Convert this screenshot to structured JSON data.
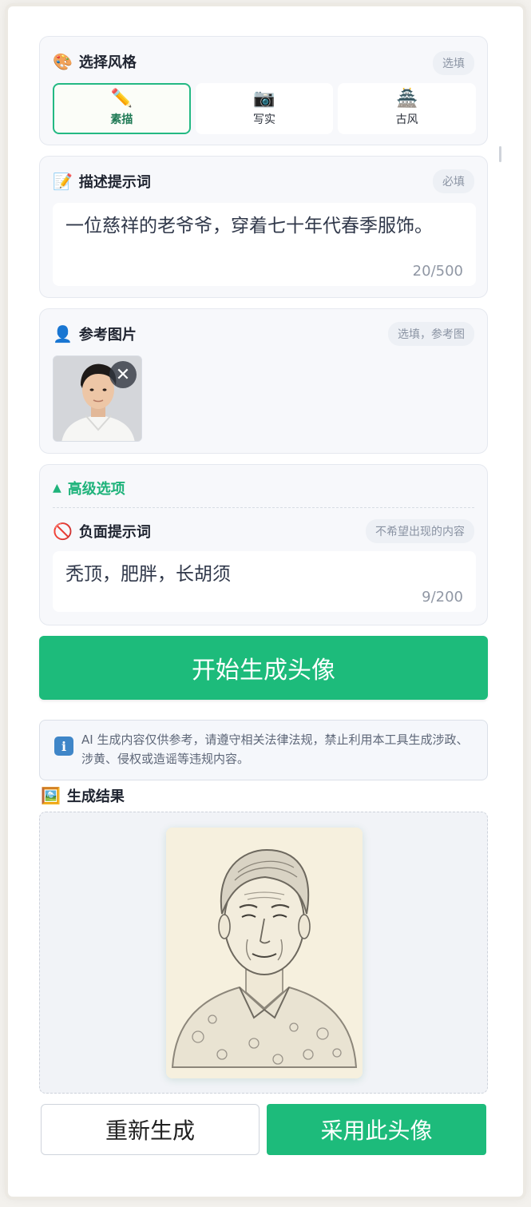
{
  "style_section": {
    "title": "选择风格",
    "icon": "palette-icon",
    "badge": "选填",
    "options": [
      {
        "label": "素描",
        "icon": "pencil-icon",
        "glyph": "✏️",
        "selected": true
      },
      {
        "label": "写实",
        "icon": "camera-icon",
        "glyph": "📷",
        "selected": false
      },
      {
        "label": "古风",
        "icon": "castle-icon",
        "glyph": "🏯",
        "selected": false
      }
    ]
  },
  "prompt_section": {
    "title": "描述提示词",
    "icon": "memo-icon",
    "badge": "必填",
    "value": "一位慈祥的老爷爷，穿着七十年代春季服饰。",
    "count": "20/500"
  },
  "reference_section": {
    "title": "参考图片",
    "icon": "bust-silhouette-icon",
    "badge": "选填，参考图",
    "remove_glyph": "✕"
  },
  "advanced_section": {
    "toggle_glyph": "▲",
    "toggle_label": "高级选项",
    "negative_title": "负面提示词",
    "negative_icon": "prohibited-icon",
    "negative_badge": "不希望出现的内容",
    "negative_value": "秃顶，肥胖，长胡须",
    "negative_count": "9/200"
  },
  "generate_button": "开始生成头像",
  "notice": {
    "icon": "info-icon",
    "glyph": "i",
    "text": "AI 生成内容仅供参考，请遵守相关法律法规，禁止利用本工具生成涉政、涉黄、侵权或造谣等违规内容。"
  },
  "result": {
    "title": "生成结果",
    "icon": "framed-picture-icon"
  },
  "actions": {
    "regenerate": "重新生成",
    "adopt": "采用此头像"
  },
  "colors": {
    "accent": "#1dbb7b",
    "accent_text": "#1fb37b",
    "card_bg": "#f7f8fb",
    "badge_bg": "#edf0f5"
  }
}
